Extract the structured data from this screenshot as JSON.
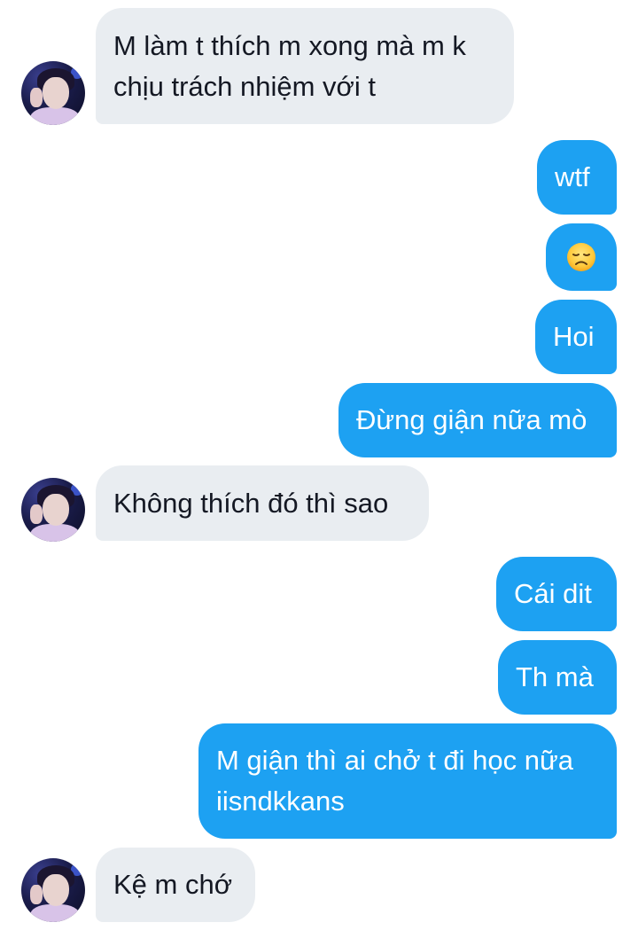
{
  "conversation": {
    "messages": [
      {
        "direction": "received",
        "text": "M làm t thích m xong mà m k\nchịu trách nhiệm với t"
      },
      {
        "direction": "sent",
        "text": "wtf"
      },
      {
        "direction": "sent",
        "text": "",
        "emoji": "disappointed-face"
      },
      {
        "direction": "sent",
        "text": "Hoi"
      },
      {
        "direction": "sent",
        "text": "Đừng giận nữa mò"
      },
      {
        "direction": "received",
        "text": "Không thích đó thì sao"
      },
      {
        "direction": "sent",
        "text": "Cái dit"
      },
      {
        "direction": "sent",
        "text": "Th mà"
      },
      {
        "direction": "sent",
        "text": "M giận thì ai chở t đi học nữa\niisndkkans"
      },
      {
        "direction": "received",
        "text": "Kệ m chớ"
      }
    ]
  },
  "colors": {
    "sent_bubble": "#1da1f2",
    "received_bubble": "#e9edf1",
    "received_text": "#141823",
    "sent_text": "#ffffff"
  }
}
